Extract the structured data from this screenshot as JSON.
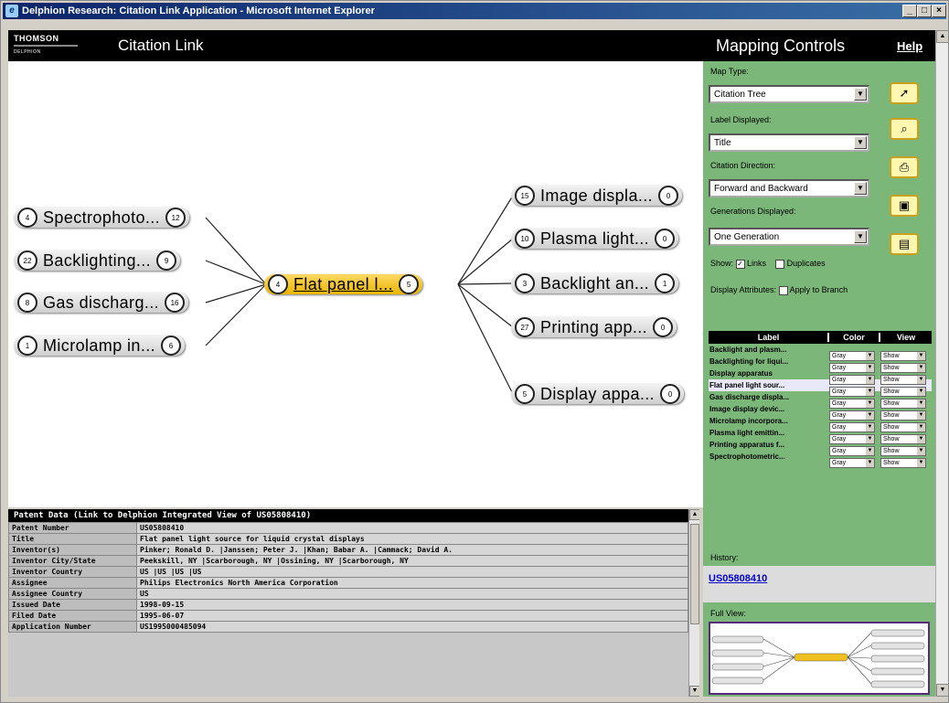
{
  "window": {
    "title": "Delphion Research: Citation Link Application - Microsoft Internet Explorer",
    "min": "_",
    "max": "□",
    "close": "×"
  },
  "header": {
    "logo_top": "THOMSON",
    "logo_bottom": "DELPHION",
    "app_title": "Citation Link"
  },
  "map": {
    "focus": {
      "count_left": "4",
      "label": "Flat panel l...",
      "count_right": "5"
    },
    "left_nodes": [
      {
        "count_left": "4",
        "label": "Spectrophoto...",
        "count_right": "12"
      },
      {
        "count_left": "22",
        "label": "Backlighting...",
        "count_right": "9"
      },
      {
        "count_left": "8",
        "label": "Gas discharg...",
        "count_right": "16"
      },
      {
        "count_left": "1",
        "label": "Microlamp in...",
        "count_right": "6"
      }
    ],
    "right_nodes": [
      {
        "count_left": "15",
        "label": "Image displa...",
        "count_right": "0"
      },
      {
        "count_left": "10",
        "label": "Plasma light...",
        "count_right": "0"
      },
      {
        "count_left": "3",
        "label": "Backlight an...",
        "count_right": "1"
      },
      {
        "count_left": "27",
        "label": "Printing app...",
        "count_right": "0"
      },
      {
        "count_left": "5",
        "label": "Display appa...",
        "count_right": "0"
      }
    ]
  },
  "patent_data": {
    "header": "Patent Data (Link to Delphion Integrated View of US05808410)",
    "rows": [
      {
        "key": "Patent Number",
        "value": "US05808410"
      },
      {
        "key": "Title",
        "value": "Flat panel light source for liquid crystal displays"
      },
      {
        "key": "Inventor(s)",
        "value": "Pinker; Ronald D. |Janssen; Peter J. |Khan; Babar A. |Cammack; David A."
      },
      {
        "key": "Inventor City/State",
        "value": "Peekskill, NY |Scarborough, NY |Ossining, NY |Scarborough, NY"
      },
      {
        "key": "Inventor Country",
        "value": "US |US |US |US"
      },
      {
        "key": "Assignee",
        "value": "Philips Electronics North America Corporation"
      },
      {
        "key": "Assignee Country",
        "value": "US"
      },
      {
        "key": "Issued Date",
        "value": "1998-09-15"
      },
      {
        "key": "Filed Date",
        "value": "1995-06-07"
      },
      {
        "key": "Application Number",
        "value": "US1995000485094"
      }
    ]
  },
  "controls": {
    "title": "Mapping Controls",
    "help": "Help",
    "map_type_label": "Map Type:",
    "map_type_value": "Citation Tree",
    "label_displayed_label": "Label Displayed:",
    "label_displayed_value": "Title",
    "direction_label": "Citation Direction:",
    "direction_value": "Forward and Backward",
    "generations_label": "Generations Displayed:",
    "generations_value": "One Generation",
    "show_label": "Show:",
    "links_label": "Links",
    "duplicates_label": "Duplicates",
    "display_attr_label": "Display Attributes:",
    "apply_branch_label": "Apply to Branch",
    "col_label": "Label",
    "col_color": "Color",
    "col_view": "View",
    "attributes": [
      {
        "label": "Backlight and plasm...",
        "color": "Gray",
        "view": "Show"
      },
      {
        "label": "Backlighting for liqui...",
        "color": "Gray",
        "view": "Show"
      },
      {
        "label": "Display apparatus",
        "color": "Gray",
        "view": "Show"
      },
      {
        "label": "Flat panel light sour...",
        "color": "Gray",
        "view": "Show"
      },
      {
        "label": "Gas discharge displa...",
        "color": "Gray",
        "view": "Show"
      },
      {
        "label": "Image display devic...",
        "color": "Gray",
        "view": "Show"
      },
      {
        "label": "Microlamp incorpora...",
        "color": "Gray",
        "view": "Show"
      },
      {
        "label": "Plasma light emittin...",
        "color": "Gray",
        "view": "Show"
      },
      {
        "label": "Printing apparatus f...",
        "color": "Gray",
        "view": "Show"
      },
      {
        "label": "Spectrophotometric...",
        "color": "Gray",
        "view": "Show"
      }
    ],
    "history_label": "History:",
    "history_link": "US05808410",
    "full_view_label": "Full View:"
  },
  "icons": {
    "select": "pointer-icon",
    "zoom": "magnifier-icon",
    "print": "printer-icon",
    "save": "disk-icon",
    "open": "folder-icon"
  },
  "colors": {
    "panel_green": "#7cb77a",
    "focus_node": "#e8b500",
    "link": "#0000cc"
  }
}
